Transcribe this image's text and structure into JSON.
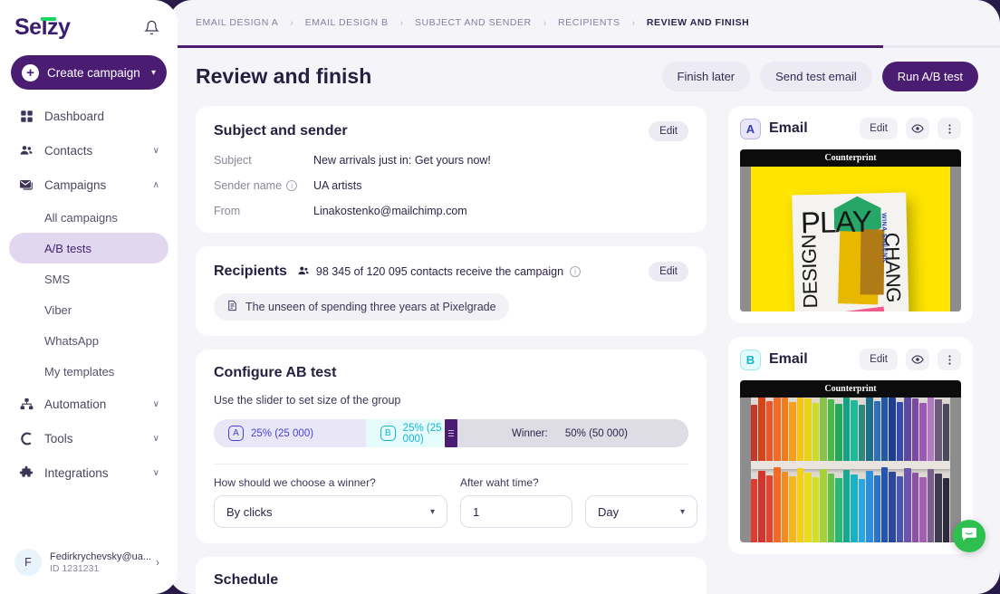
{
  "brand": {
    "name": "Selzy",
    "accent": "#17d85f",
    "primary": "#4a1d73"
  },
  "sidebar": {
    "create_button": "Create campaign",
    "items": [
      {
        "label": "Dashboard",
        "icon": "grid-icon",
        "chevron": ""
      },
      {
        "label": "Contacts",
        "icon": "people-icon",
        "chevron": "∨"
      },
      {
        "label": "Campaigns",
        "icon": "envelope-icon",
        "chevron": "∧"
      }
    ],
    "sub_items": [
      {
        "label": "All campaigns",
        "active": false
      },
      {
        "label": "A/B tests",
        "active": true
      },
      {
        "label": "SMS",
        "active": false
      },
      {
        "label": "Viber",
        "active": false
      },
      {
        "label": "WhatsApp",
        "active": false
      },
      {
        "label": "My templates",
        "active": false
      }
    ],
    "items_bottom": [
      {
        "label": "Automation",
        "icon": "hierarchy-icon",
        "chevron": "∨"
      },
      {
        "label": "Tools",
        "icon": "magnet-icon",
        "chevron": "∨"
      },
      {
        "label": "Integrations",
        "icon": "puzzle-icon",
        "chevron": "∨"
      }
    ],
    "user": {
      "initial": "F",
      "name": "Fedirkrychevsky@ua...",
      "id": "ID 1231231",
      "arrow": "›"
    }
  },
  "breadcrumb": {
    "items": [
      {
        "label": "EMAIL DESIGN A",
        "current": false
      },
      {
        "label": "EMAIL DESIGN B",
        "current": false
      },
      {
        "label": "SUBJECT AND SENDER",
        "current": false
      },
      {
        "label": "RECIPIENTS",
        "current": false
      },
      {
        "label": "REVIEW AND FINISH",
        "current": true
      }
    ],
    "separator": "›",
    "progress_percent": "86%"
  },
  "header": {
    "title": "Review and finish",
    "finish_later": "Finish later",
    "send_test_email": "Send test email",
    "run_ab_test": "Run A/B test"
  },
  "subject_card": {
    "title": "Subject and sender",
    "edit": "Edit",
    "rows": [
      {
        "key": "Subject",
        "value": "New arrivals just in: Get yours now!",
        "info": false
      },
      {
        "key": "Sender name",
        "value": "UA artists",
        "info": true
      },
      {
        "key": "From",
        "value": "Linakostenko@mailchimp.com",
        "info": false
      }
    ]
  },
  "recipients_card": {
    "title": "Recipients",
    "stat": "98 345 of 120 095 contacts receive the campaign",
    "edit": "Edit",
    "segment_chip": "The unseen of spending three years at Pixelgrade"
  },
  "ab_card": {
    "title": "Configure AB test",
    "slider_hint": "Use the slider to set size of the group",
    "segment_a": {
      "badge": "A",
      "label": "25% (25 000)",
      "width_percent": 32
    },
    "segment_b": {
      "badge": "B",
      "label": "25% (25 000)",
      "width_percent": 18
    },
    "winner": {
      "prefix": "Winner:",
      "label": "50% (50 000)"
    },
    "winner_field_label": "How should we choose a winner?",
    "winner_field_value": "By clicks",
    "time_field_label": "After waht time?",
    "time_value": "1",
    "unit_value": "Day",
    "chevron": "∨"
  },
  "schedule_card": {
    "title": "Schedule"
  },
  "previews": [
    {
      "badge": "A",
      "title": "Email",
      "edit": "Edit",
      "banner": "Counterprint",
      "art": "book-cover-play-design-change",
      "art_texts": {
        "main": "PLAY",
        "left": "DESIGN",
        "right": "CHANG",
        "small": "WINA SHEENK"
      }
    },
    {
      "badge": "B",
      "title": "Email",
      "edit": "Edit",
      "banner": "Counterprint",
      "art": "rainbow-bookshelf",
      "art_texts": {
        "main": "",
        "left": "",
        "right": "",
        "small": ""
      }
    }
  ],
  "chat_widget": {
    "icon": "chat-bubble-icon",
    "color": "#2fbf4e"
  }
}
